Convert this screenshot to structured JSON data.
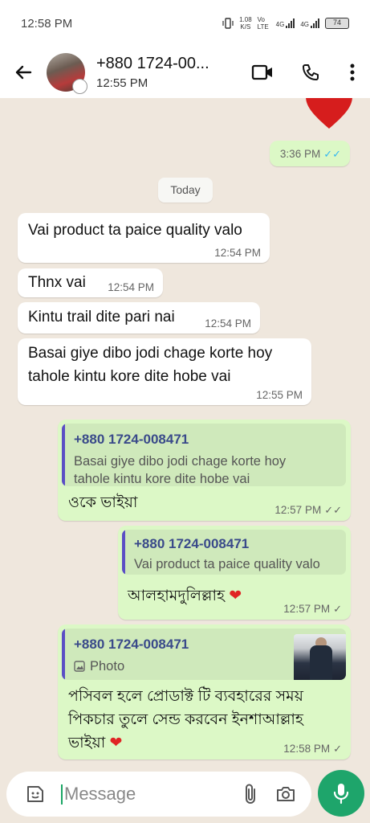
{
  "status_bar": {
    "time": "12:58 PM",
    "network_speed": "1.08",
    "network_speed_unit": "K/S",
    "volte": "Vo LTE",
    "signal1": "4G",
    "signal2": "4G",
    "battery": "74"
  },
  "header": {
    "contact_name": "+880 1724-00...",
    "subtitle": "12:55 PM"
  },
  "date_divider": "Today",
  "messages": [
    {
      "id": "m0",
      "direction": "outgoing",
      "text": "❤",
      "time": "3:36 PM",
      "status": "read"
    },
    {
      "id": "m1",
      "direction": "incoming",
      "text": "Vai product ta paice quality valo",
      "time": "12:54 PM"
    },
    {
      "id": "m2",
      "direction": "incoming",
      "text": "Thnx vai",
      "time": "12:54 PM"
    },
    {
      "id": "m3",
      "direction": "incoming",
      "text": "Kintu trail dite pari nai",
      "time": "12:54 PM"
    },
    {
      "id": "m4",
      "direction": "incoming",
      "text_line1": "Basai giye dibo jodi chage korte hoy",
      "text_line2": "tahole kintu kore dite hobe vai",
      "time": "12:55 PM"
    },
    {
      "id": "m5",
      "direction": "outgoing",
      "quote_name": "+880 1724-008471",
      "quote_line1": "Basai giye dibo jodi chage korte hoy",
      "quote_line2": "tahole kintu kore dite hobe vai",
      "text": "ওকে ভাইয়া",
      "time": "12:57 PM",
      "status": "delivered"
    },
    {
      "id": "m6",
      "direction": "outgoing",
      "quote_name": "+880 1724-008471",
      "quote_text": "Vai product ta paice quality valo",
      "text": "আলহামদুলিল্লাহ",
      "emoji": "❤",
      "time": "12:57 PM",
      "status": "sent"
    },
    {
      "id": "m7",
      "direction": "outgoing",
      "quote_name": "+880 1724-008471",
      "quote_text": "Photo",
      "text_line1": "পসিবল হলে প্রোডাক্ট টি ব্যবহারের সময়",
      "text_line2": "পিকচার তুলে সেন্ড করবেন ইনশাআল্লাহ",
      "text_line3": "ভাইয়া",
      "emoji": "❤",
      "time": "12:58 PM",
      "status": "sent"
    }
  ],
  "composer": {
    "placeholder": "Message"
  },
  "colors": {
    "incoming_bg": "#ffffff",
    "outgoing_bg": "#dcf8c6",
    "read_tick": "#34b7f1",
    "accent_green": "#1ea56b",
    "quote_bar": "#5b4ec5"
  },
  "icons": [
    "back-arrow-icon",
    "video-call-icon",
    "voice-call-icon",
    "more-options-icon",
    "sticker-icon",
    "attach-icon",
    "camera-icon",
    "mic-icon",
    "photo-icon"
  ]
}
